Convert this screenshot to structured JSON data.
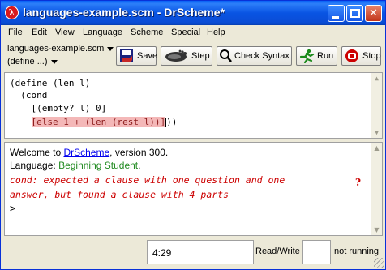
{
  "window": {
    "title": "languages-example.scm - DrScheme*",
    "icon_letter": "λ"
  },
  "menu": [
    "File",
    "Edit",
    "View",
    "Language",
    "Scheme",
    "Special",
    "Help"
  ],
  "toolbar": {
    "file_name": "languages-example.scm",
    "define_menu": "(define ...)",
    "save": "Save",
    "step": "Step",
    "check_syntax": "Check Syntax",
    "run": "Run",
    "stop": "Stop"
  },
  "editor": {
    "lines": [
      "(define (len l)",
      "  (cond",
      "    [(empty? l) 0]",
      "    [else 1 + (len (rest l))]))"
    ]
  },
  "interactions": {
    "welcome_prefix": "Welcome to ",
    "welcome_link": "DrScheme",
    "welcome_suffix": ", version 300.",
    "language_prefix": "Language: ",
    "language_name": "Beginning Student",
    "language_suffix": ".",
    "error_line1": "cond: expected a clause with one question and one",
    "error_line2": "answer, but found a clause with 4 parts",
    "error_icon": "?",
    "prompt": ">"
  },
  "status": {
    "position": "4:29",
    "mode": "Read/Write",
    "state": "not running"
  },
  "colors": {
    "titlebar": "#0954e3",
    "keyword": "#132f9b",
    "literal": "#228b22",
    "error": "#cc0000",
    "highlight": "#f4b8b8"
  }
}
